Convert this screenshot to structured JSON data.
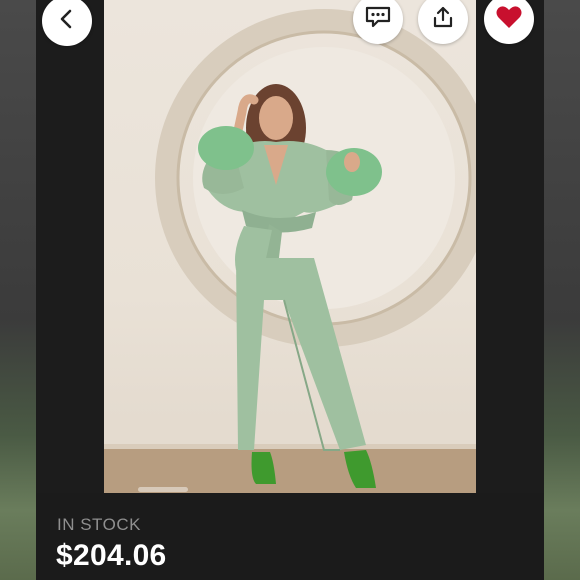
{
  "product": {
    "stock_status": "IN STOCK",
    "price": "$204.06",
    "image_count_indicator": 1
  },
  "actions": {
    "back_icon": "chevron-left-icon",
    "comment_icon": "comment-icon",
    "share_icon": "share-icon",
    "like_icon": "heart-icon"
  },
  "colors": {
    "heart": "#c8102e",
    "outfit": "#9fc0a0",
    "background": "#1b1b1b",
    "stock_text": "#8f8f8f",
    "price_text": "#ffffff"
  }
}
